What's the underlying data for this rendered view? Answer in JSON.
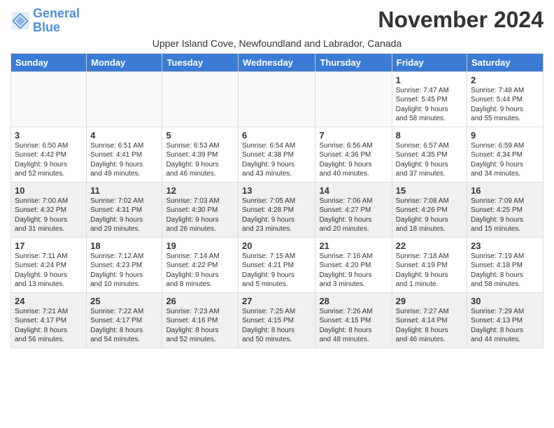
{
  "logo": {
    "line1": "General",
    "line2": "Blue"
  },
  "title": "November 2024",
  "subtitle": "Upper Island Cove, Newfoundland and Labrador, Canada",
  "days_of_week": [
    "Sunday",
    "Monday",
    "Tuesday",
    "Wednesday",
    "Thursday",
    "Friday",
    "Saturday"
  ],
  "weeks": [
    [
      {
        "day": "",
        "info": "",
        "empty": true
      },
      {
        "day": "",
        "info": "",
        "empty": true
      },
      {
        "day": "",
        "info": "",
        "empty": true
      },
      {
        "day": "",
        "info": "",
        "empty": true
      },
      {
        "day": "",
        "info": "",
        "empty": true
      },
      {
        "day": "1",
        "info": "Sunrise: 7:47 AM\nSunset: 5:45 PM\nDaylight: 9 hours\nand 58 minutes.",
        "empty": false
      },
      {
        "day": "2",
        "info": "Sunrise: 7:48 AM\nSunset: 5:44 PM\nDaylight: 9 hours\nand 55 minutes.",
        "empty": false
      }
    ],
    [
      {
        "day": "3",
        "info": "Sunrise: 6:50 AM\nSunset: 4:42 PM\nDaylight: 9 hours\nand 52 minutes.",
        "empty": false
      },
      {
        "day": "4",
        "info": "Sunrise: 6:51 AM\nSunset: 4:41 PM\nDaylight: 9 hours\nand 49 minutes.",
        "empty": false
      },
      {
        "day": "5",
        "info": "Sunrise: 6:53 AM\nSunset: 4:39 PM\nDaylight: 9 hours\nand 46 minutes.",
        "empty": false
      },
      {
        "day": "6",
        "info": "Sunrise: 6:54 AM\nSunset: 4:38 PM\nDaylight: 9 hours\nand 43 minutes.",
        "empty": false
      },
      {
        "day": "7",
        "info": "Sunrise: 6:56 AM\nSunset: 4:36 PM\nDaylight: 9 hours\nand 40 minutes.",
        "empty": false
      },
      {
        "day": "8",
        "info": "Sunrise: 6:57 AM\nSunset: 4:35 PM\nDaylight: 9 hours\nand 37 minutes.",
        "empty": false
      },
      {
        "day": "9",
        "info": "Sunrise: 6:59 AM\nSunset: 4:34 PM\nDaylight: 9 hours\nand 34 minutes.",
        "empty": false
      }
    ],
    [
      {
        "day": "10",
        "info": "Sunrise: 7:00 AM\nSunset: 4:32 PM\nDaylight: 9 hours\nand 31 minutes.",
        "empty": false
      },
      {
        "day": "11",
        "info": "Sunrise: 7:02 AM\nSunset: 4:31 PM\nDaylight: 9 hours\nand 29 minutes.",
        "empty": false
      },
      {
        "day": "12",
        "info": "Sunrise: 7:03 AM\nSunset: 4:30 PM\nDaylight: 9 hours\nand 26 minutes.",
        "empty": false
      },
      {
        "day": "13",
        "info": "Sunrise: 7:05 AM\nSunset: 4:28 PM\nDaylight: 9 hours\nand 23 minutes.",
        "empty": false
      },
      {
        "day": "14",
        "info": "Sunrise: 7:06 AM\nSunset: 4:27 PM\nDaylight: 9 hours\nand 20 minutes.",
        "empty": false
      },
      {
        "day": "15",
        "info": "Sunrise: 7:08 AM\nSunset: 4:26 PM\nDaylight: 9 hours\nand 18 minutes.",
        "empty": false
      },
      {
        "day": "16",
        "info": "Sunrise: 7:09 AM\nSunset: 4:25 PM\nDaylight: 9 hours\nand 15 minutes.",
        "empty": false
      }
    ],
    [
      {
        "day": "17",
        "info": "Sunrise: 7:11 AM\nSunset: 4:24 PM\nDaylight: 9 hours\nand 13 minutes.",
        "empty": false
      },
      {
        "day": "18",
        "info": "Sunrise: 7:12 AM\nSunset: 4:23 PM\nDaylight: 9 hours\nand 10 minutes.",
        "empty": false
      },
      {
        "day": "19",
        "info": "Sunrise: 7:14 AM\nSunset: 4:22 PM\nDaylight: 9 hours\nand 8 minutes.",
        "empty": false
      },
      {
        "day": "20",
        "info": "Sunrise: 7:15 AM\nSunset: 4:21 PM\nDaylight: 9 hours\nand 5 minutes.",
        "empty": false
      },
      {
        "day": "21",
        "info": "Sunrise: 7:16 AM\nSunset: 4:20 PM\nDaylight: 9 hours\nand 3 minutes.",
        "empty": false
      },
      {
        "day": "22",
        "info": "Sunrise: 7:18 AM\nSunset: 4:19 PM\nDaylight: 9 hours\nand 1 minute.",
        "empty": false
      },
      {
        "day": "23",
        "info": "Sunrise: 7:19 AM\nSunset: 4:18 PM\nDaylight: 8 hours\nand 58 minutes.",
        "empty": false
      }
    ],
    [
      {
        "day": "24",
        "info": "Sunrise: 7:21 AM\nSunset: 4:17 PM\nDaylight: 8 hours\nand 56 minutes.",
        "empty": false
      },
      {
        "day": "25",
        "info": "Sunrise: 7:22 AM\nSunset: 4:17 PM\nDaylight: 8 hours\nand 54 minutes.",
        "empty": false
      },
      {
        "day": "26",
        "info": "Sunrise: 7:23 AM\nSunset: 4:16 PM\nDaylight: 8 hours\nand 52 minutes.",
        "empty": false
      },
      {
        "day": "27",
        "info": "Sunrise: 7:25 AM\nSunset: 4:15 PM\nDaylight: 8 hours\nand 50 minutes.",
        "empty": false
      },
      {
        "day": "28",
        "info": "Sunrise: 7:26 AM\nSunset: 4:15 PM\nDaylight: 8 hours\nand 48 minutes.",
        "empty": false
      },
      {
        "day": "29",
        "info": "Sunrise: 7:27 AM\nSunset: 4:14 PM\nDaylight: 8 hours\nand 46 minutes.",
        "empty": false
      },
      {
        "day": "30",
        "info": "Sunrise: 7:29 AM\nSunset: 4:13 PM\nDaylight: 8 hours\nand 44 minutes.",
        "empty": false
      }
    ]
  ]
}
